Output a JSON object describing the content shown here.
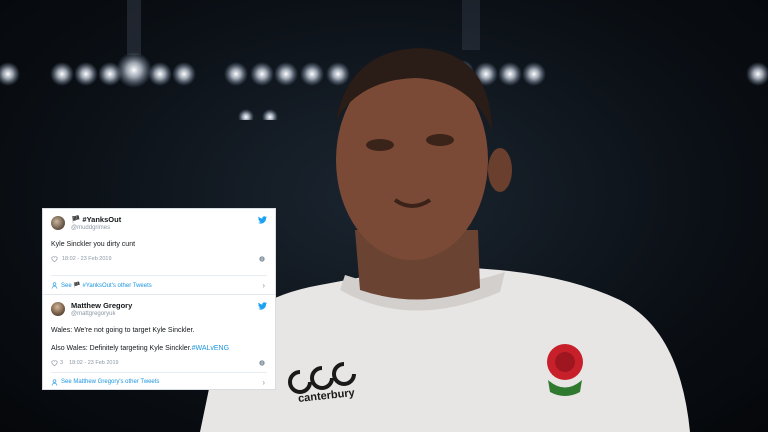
{
  "tweets": [
    {
      "display_name": "🏴 #YanksOut",
      "handle": "@muddgrimes",
      "text_lines": [
        "Kyle Sinckler you dirty cunt"
      ],
      "likes": "",
      "timestamp": "18:02 - 23 Feb 2019",
      "see_more": "See 🏴 #YanksOut's other Tweets"
    },
    {
      "display_name": "Matthew Gregory",
      "handle": "@mattgregoryuk",
      "text_line_1": "Wales: We're not going to target Kyle Sinckler.",
      "text_line_2_prefix": "Also Wales: Definitely targeting Kyle Sinckler.",
      "text_line_2_hashtag": "#WALvENG",
      "likes": "3",
      "timestamp": "18:02 - 23 Feb 2019",
      "see_more": "See Matthew Gregory's other Tweets"
    }
  ],
  "shirt": {
    "brand": "canterbury"
  },
  "colors": {
    "twitter_blue": "#1da1f2",
    "link_blue": "#1b95e0",
    "muted": "#8b98a5"
  },
  "icons": [
    "twitter-bird-icon",
    "heart-icon",
    "info-icon",
    "profile-icon",
    "chevron-right-icon",
    "flag-icon"
  ]
}
